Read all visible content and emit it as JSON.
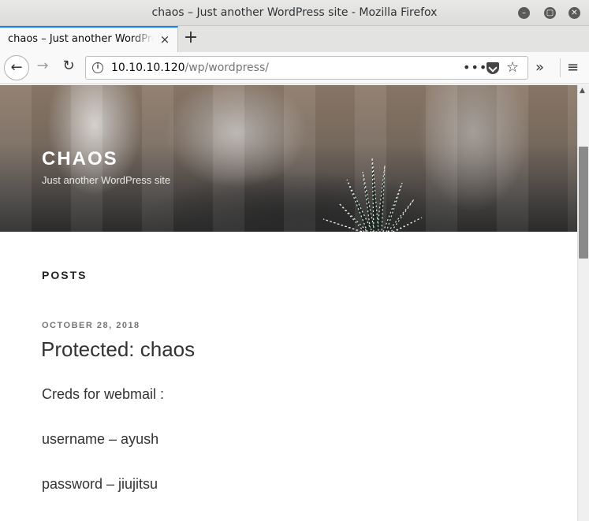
{
  "window": {
    "title": "chaos – Just another WordPress site - Mozilla Firefox",
    "minimize_icon": "minimize-icon",
    "maximize_icon": "maximize-icon",
    "close_icon": "close-icon"
  },
  "tabs": [
    {
      "label": "chaos – Just another WordPress site",
      "close": "×"
    }
  ],
  "newtab_label": "+",
  "nav": {
    "back": "←",
    "forward": "→",
    "reload": "↻",
    "url_host": "10.10.10.120",
    "url_path": "/wp/wordpress/",
    "more": "•••",
    "bookmark": "☆",
    "overflow": "»",
    "menu": "≡"
  },
  "site": {
    "title": "CHAOS",
    "description": "Just another WordPress site"
  },
  "content": {
    "section_heading": "POSTS",
    "post": {
      "date": "OCTOBER 28, 2018",
      "title": "Protected: chaos",
      "paragraphs": [
        "Creds for webmail :",
        "username – ayush",
        "password – jiujitsu"
      ]
    }
  }
}
